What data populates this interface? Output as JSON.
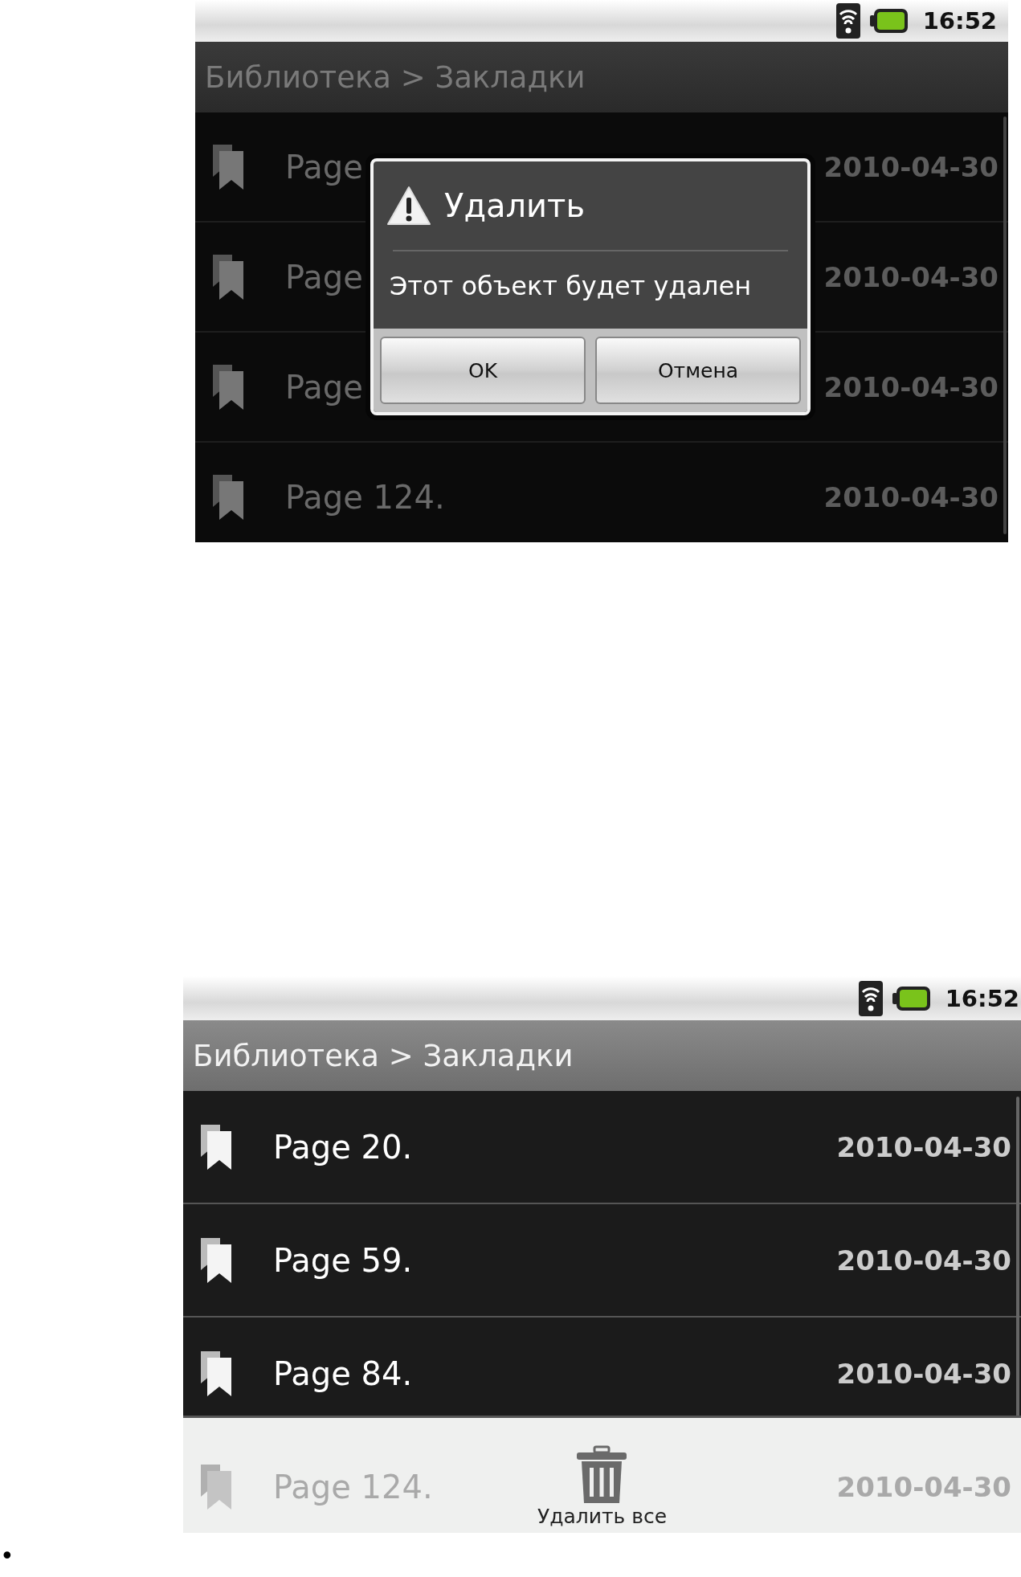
{
  "screens": [
    {
      "status_bar": {
        "time": "16:52"
      },
      "title": "Библиотека > Закладки",
      "dimmed": true,
      "bookmarks": [
        {
          "label": "Page",
          "date": "2010-04-30"
        },
        {
          "label": "Page",
          "date": "2010-04-30"
        },
        {
          "label": "Page",
          "date": "2010-04-30"
        },
        {
          "label": "Page 124.",
          "date": "2010-04-30"
        }
      ],
      "dialog": {
        "title": "Удалить",
        "message": "Этот объект будет удален",
        "buttons": [
          "OK",
          "Отмена"
        ]
      }
    },
    {
      "status_bar": {
        "time": "16:52"
      },
      "title": "Библиотека > Закладки",
      "dimmed": false,
      "bookmarks": [
        {
          "label": "Page 20.",
          "date": "2010-04-30"
        },
        {
          "label": "Page 59.",
          "date": "2010-04-30"
        },
        {
          "label": "Page 84.",
          "date": "2010-04-30"
        },
        {
          "label": "Page 124.",
          "date": "2010-04-30",
          "under_menu": true
        }
      ],
      "menu": {
        "items": [
          {
            "label": "Удалить все"
          }
        ]
      }
    }
  ],
  "footer": {
    "bullet": "•"
  }
}
